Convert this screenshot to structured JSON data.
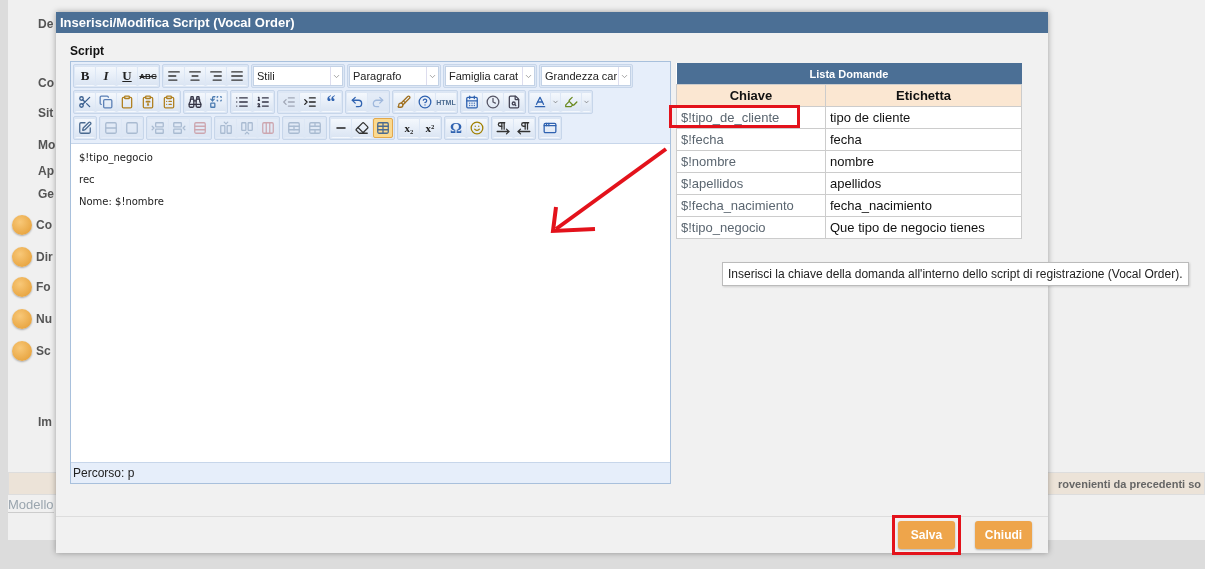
{
  "background": {
    "labels": [
      {
        "text": "De",
        "info": false
      },
      {
        "text": "Co",
        "info": false
      },
      {
        "text": "Sit",
        "info": false
      },
      {
        "text": "Mo",
        "info": false
      },
      {
        "text": "Ap",
        "info": false
      },
      {
        "text": "Ge",
        "info": false
      },
      {
        "text": "Co",
        "info": true
      },
      {
        "text": "Dir",
        "info": true
      },
      {
        "text": "Fo",
        "info": true
      },
      {
        "text": "Nu",
        "info": true
      },
      {
        "text": "Sc",
        "info": true
      },
      {
        "text": "Im",
        "info": false
      }
    ],
    "banner": "rovenienti da precedenti so",
    "footer_label": "Modello"
  },
  "dialog": {
    "title": "Inserisci/Modifica Script (Vocal Order)",
    "section_label": "Script",
    "toolbar": [
      [
        [
          {
            "kind": "bold",
            "label": "B",
            "disabled": false,
            "pressed": false
          },
          {
            "kind": "italic",
            "label": "I",
            "disabled": false,
            "pressed": false
          },
          {
            "kind": "underline",
            "label": "U",
            "disabled": false,
            "pressed": false
          },
          {
            "kind": "strike",
            "label": "ABC",
            "disabled": false,
            "pressed": false
          }
        ],
        [
          {
            "kind": "alignleft",
            "disabled": false,
            "pressed": false
          },
          {
            "kind": "aligncenter",
            "disabled": false,
            "pressed": false
          },
          {
            "kind": "alignright",
            "disabled": false,
            "pressed": false
          },
          {
            "kind": "justify",
            "disabled": false,
            "pressed": false
          }
        ],
        [
          {
            "kind": "select",
            "label": "Stili"
          }
        ],
        [
          {
            "kind": "select",
            "label": "Paragrafo"
          }
        ],
        [
          {
            "kind": "select",
            "label": "Famiglia carat"
          }
        ],
        [
          {
            "kind": "select",
            "label": "Grandezza car"
          }
        ]
      ],
      [
        [
          {
            "kind": "cut",
            "disabled": false,
            "pressed": false
          },
          {
            "kind": "copy",
            "disabled": false,
            "pressed": false
          },
          {
            "kind": "paste",
            "disabled": false,
            "pressed": false
          },
          {
            "kind": "pastetext",
            "disabled": false,
            "pressed": false
          },
          {
            "kind": "pasteword",
            "disabled": false,
            "pressed": false
          }
        ],
        [
          {
            "kind": "find",
            "disabled": false,
            "pressed": false
          },
          {
            "kind": "replace",
            "disabled": false,
            "pressed": false
          }
        ],
        [
          {
            "kind": "bullets",
            "disabled": false,
            "pressed": false
          },
          {
            "kind": "numbers",
            "disabled": false,
            "pressed": false
          }
        ],
        [
          {
            "kind": "outdent",
            "disabled": true,
            "pressed": false
          },
          {
            "kind": "indent",
            "disabled": false,
            "pressed": false
          },
          {
            "kind": "quote",
            "label": "“",
            "disabled": false,
            "pressed": false
          }
        ],
        [
          {
            "kind": "undo",
            "disabled": false,
            "pressed": false
          },
          {
            "kind": "redo",
            "disabled": true,
            "pressed": false
          }
        ],
        [
          {
            "kind": "cleanup",
            "disabled": false,
            "pressed": false
          },
          {
            "kind": "help",
            "disabled": false,
            "pressed": false
          },
          {
            "kind": "html",
            "label": "HTML",
            "disabled": false,
            "pressed": false
          }
        ],
        [
          {
            "kind": "date",
            "disabled": false,
            "pressed": false
          },
          {
            "kind": "time",
            "disabled": false,
            "pressed": false
          },
          {
            "kind": "preview",
            "disabled": false,
            "pressed": false
          }
        ],
        [
          {
            "kind": "forecolor",
            "disabled": false,
            "pressed": false
          },
          {
            "kind": "caret",
            "disabled": false,
            "pressed": false
          },
          {
            "kind": "backcolor",
            "disabled": false,
            "pressed": false
          },
          {
            "kind": "caret",
            "disabled": false,
            "pressed": false
          }
        ]
      ],
      [
        [
          {
            "kind": "tableprops",
            "disabled": false,
            "pressed": false
          }
        ],
        [
          {
            "kind": "rowprops",
            "disabled": true,
            "pressed": false
          },
          {
            "kind": "cellprops",
            "disabled": true,
            "pressed": false
          }
        ],
        [
          {
            "kind": "rowbefore",
            "disabled": true,
            "pressed": false
          },
          {
            "kind": "rowafter",
            "disabled": true,
            "pressed": false
          },
          {
            "kind": "deleterow",
            "disabled": true,
            "pressed": false
          }
        ],
        [
          {
            "kind": "colbefore",
            "disabled": true,
            "pressed": false
          },
          {
            "kind": "colafter",
            "disabled": true,
            "pressed": false
          },
          {
            "kind": "deletecol",
            "disabled": true,
            "pressed": false
          }
        ],
        [
          {
            "kind": "split",
            "disabled": true,
            "pressed": false
          },
          {
            "kind": "merge",
            "disabled": true,
            "pressed": false
          }
        ],
        [
          {
            "kind": "hr",
            "disabled": false,
            "pressed": false
          },
          {
            "kind": "eraser",
            "disabled": false,
            "pressed": false
          },
          {
            "kind": "table",
            "disabled": false,
            "pressed": true
          }
        ],
        [
          {
            "kind": "sub",
            "label": "x₂",
            "disabled": false,
            "pressed": false
          },
          {
            "kind": "sup",
            "label": "x²",
            "disabled": false,
            "pressed": false
          }
        ],
        [
          {
            "kind": "charmap",
            "label": "Ω",
            "disabled": false,
            "pressed": false
          },
          {
            "kind": "emoji",
            "disabled": false,
            "pressed": false
          }
        ],
        [
          {
            "kind": "ltr",
            "disabled": false,
            "pressed": false
          },
          {
            "kind": "rtl",
            "disabled": false,
            "pressed": false
          }
        ],
        [
          {
            "kind": "fullscreen",
            "disabled": false,
            "pressed": false
          }
        ]
      ]
    ],
    "content": [
      "$!tipo_negocio",
      "rec",
      "Nome: $!nombre"
    ],
    "status": "Percorso: p",
    "questions": {
      "title": "Lista Domande",
      "columns": [
        "Chiave",
        "Etichetta"
      ],
      "rows": [
        {
          "key": "$!tipo_de_cliente",
          "label": "tipo de cliente",
          "annotated": true
        },
        {
          "key": "$!fecha",
          "label": "fecha",
          "annotated": false
        },
        {
          "key": "$!nombre",
          "label": "nombre",
          "annotated": false
        },
        {
          "key": "$!apellidos",
          "label": "apellidos",
          "annotated": false
        },
        {
          "key": "$!fecha_nacimiento",
          "label": "fecha_nacimiento",
          "annotated": false
        },
        {
          "key": "$!tipo_negocio",
          "label": "Que tipo de negocio tienes",
          "annotated": false
        }
      ]
    },
    "tooltip": "Inserisci la chiave della domanda all'interno dello script di registrazione (Vocal Order).",
    "buttons": [
      {
        "label": "Salva",
        "annotated": true
      },
      {
        "label": "Chiudi",
        "annotated": false
      }
    ]
  }
}
